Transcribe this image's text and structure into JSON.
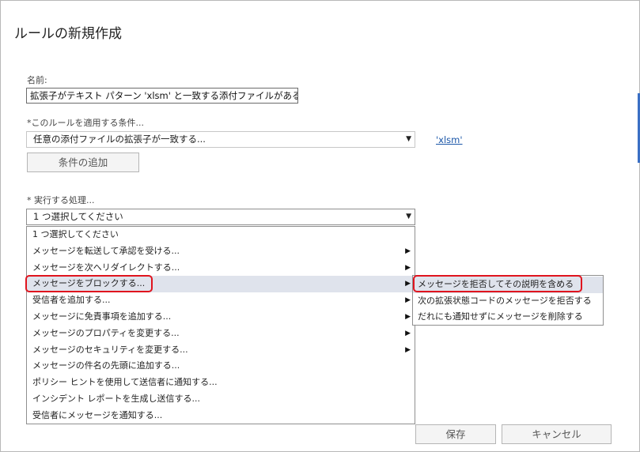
{
  "dialog": {
    "title": "ルールの新規作成"
  },
  "name_field": {
    "label": "名前:",
    "value": "拡張子がテキスト パターン 'xlsm' と一致する添付ファイルがある"
  },
  "condition": {
    "label": "*このルールを適用する条件...",
    "selected": "任意の添付ファイルの拡張子が一致する...",
    "value_link": "'xlsm'",
    "add_button": "条件の追加"
  },
  "action": {
    "label": "* 実行する処理...",
    "selected": "1 つ選択してください",
    "options": [
      {
        "label": "1 つ選択してください",
        "submenu": false
      },
      {
        "label": "メッセージを転送して承認を受ける...",
        "submenu": true
      },
      {
        "label": "メッセージを次へリダイレクトする...",
        "submenu": true
      },
      {
        "label": "メッセージをブロックする...",
        "submenu": true
      },
      {
        "label": "受信者を追加する...",
        "submenu": true
      },
      {
        "label": "メッセージに免責事項を追加する...",
        "submenu": true
      },
      {
        "label": "メッセージのプロパティを変更する...",
        "submenu": true
      },
      {
        "label": "メッセージのセキュリティを変更する...",
        "submenu": true
      },
      {
        "label": "メッセージの件名の先頭に追加する...",
        "submenu": false
      },
      {
        "label": "ポリシー ヒントを使用して送信者に通知する...",
        "submenu": false
      },
      {
        "label": "インシデント レポートを生成し送信する...",
        "submenu": false
      },
      {
        "label": "受信者にメッセージを通知する...",
        "submenu": false
      }
    ],
    "highlighted_index": 3,
    "block_submenu": [
      "メッセージを拒否してその説明を含める",
      "次の拡張状態コードのメッセージを拒否する",
      "だれにも通知せずにメッセージを削除する"
    ],
    "submenu_highlighted_index": 0
  },
  "footer": {
    "save": "保存",
    "cancel": "キャンセル"
  },
  "icons": {
    "dropdown_arrow": "▼",
    "submenu_arrow": "▶"
  },
  "colors": {
    "highlight_box": "#e0141e",
    "link": "#1a56a8",
    "hover": "#dfe3ec"
  }
}
